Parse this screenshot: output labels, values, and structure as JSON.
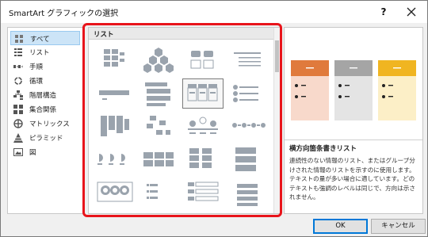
{
  "window": {
    "title": "SmartArt グラフィックの選択",
    "help": "?"
  },
  "categories": [
    {
      "label": "すべて",
      "icon": "grid-icon",
      "selected": true
    },
    {
      "label": "リスト",
      "icon": "list-icon"
    },
    {
      "label": "手順",
      "icon": "process-icon"
    },
    {
      "label": "循環",
      "icon": "cycle-icon"
    },
    {
      "label": "階層構造",
      "icon": "hierarchy-icon"
    },
    {
      "label": "集合関係",
      "icon": "relationship-icon"
    },
    {
      "label": "マトリックス",
      "icon": "matrix-icon"
    },
    {
      "label": "ピラミッド",
      "icon": "pyramid-icon"
    },
    {
      "label": "図",
      "icon": "picture-icon"
    }
  ],
  "gallery": {
    "title": "リスト",
    "tiles": [
      "basic-block-list",
      "hexagon-cluster",
      "vertical-box-list",
      "bullet-list",
      "stacked-list",
      "trapezoid-list",
      "horizontal-bullet-list-selected",
      "pie-process-list",
      "vertical-bullet-list",
      "table-list",
      "circle-accent-timeline",
      "dot-list",
      "accent-list",
      "puzzle-list",
      "grouped-list",
      "vertical-block-list",
      "picture-accent-list",
      "vertical-picture-list",
      "lined-list",
      "tab-list"
    ],
    "selected_index": 6
  },
  "preview": {
    "title": "横方向箇条書きリスト",
    "description": "連続性のない情報のリスト、またはグループ分けされた情報のリストを示すのに使用します。テキストの量が多い場合に適しています。どのテキストも強調のレベルは同じで、方向は示されません。",
    "swatches": [
      "#e07a3c",
      "#a5a5a5",
      "#f0b521"
    ],
    "swatch_bodies": [
      "#f8d9cb",
      "#e4e4e4",
      "#fcefc7"
    ]
  },
  "buttons": {
    "ok": "OK",
    "cancel": "キャンセル"
  },
  "accent_color": "#e8141b"
}
